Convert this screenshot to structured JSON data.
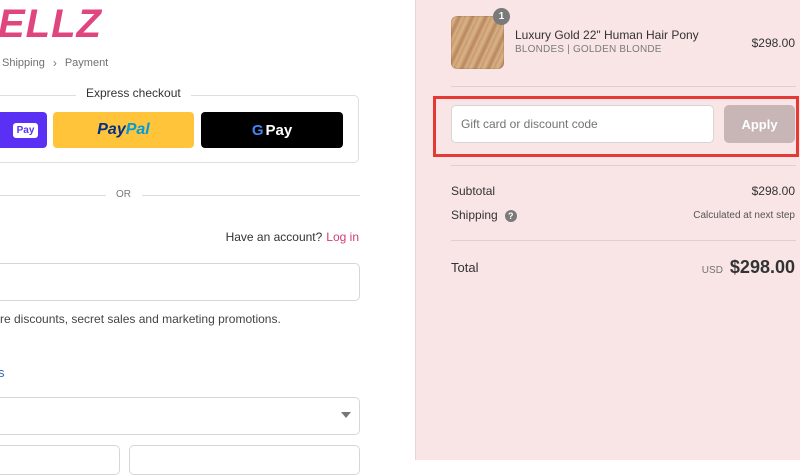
{
  "brand": {
    "logo_text": "ELLZ"
  },
  "breadcrumb": {
    "shipping": "Shipping",
    "separator": "›",
    "payment": "Payment"
  },
  "express_checkout": {
    "title": "Express checkout",
    "shop_pay_label": "Pay",
    "paypal_label_1": "Pay",
    "paypal_label_2": "Pal",
    "gpay_g": "G",
    "gpay_label": "Pay"
  },
  "divider_text": "OR",
  "account": {
    "prompt": "Have an account?",
    "login_link": "Log in"
  },
  "contact": {
    "promo_text": "re discounts, secret sales and marketing promotions."
  },
  "delivery": {
    "link_text": "s"
  },
  "order_summary": {
    "item": {
      "quantity": "1",
      "name": "Luxury Gold 22\" Human Hair Pony",
      "variant": "BLONDES | GOLDEN BLONDE",
      "price": "$298.00"
    },
    "discount": {
      "placeholder": "Gift card or discount code",
      "apply_label": "Apply"
    },
    "subtotal": {
      "label": "Subtotal",
      "value": "$298.00"
    },
    "shipping": {
      "label": "Shipping",
      "value": "Calculated at next step",
      "help": "?"
    },
    "total": {
      "label": "Total",
      "currency": "USD",
      "value": "$298.00"
    }
  },
  "colors": {
    "accent": "#d23c79",
    "sidebar_bg": "#f9e5e6",
    "highlight": "#e53935"
  }
}
